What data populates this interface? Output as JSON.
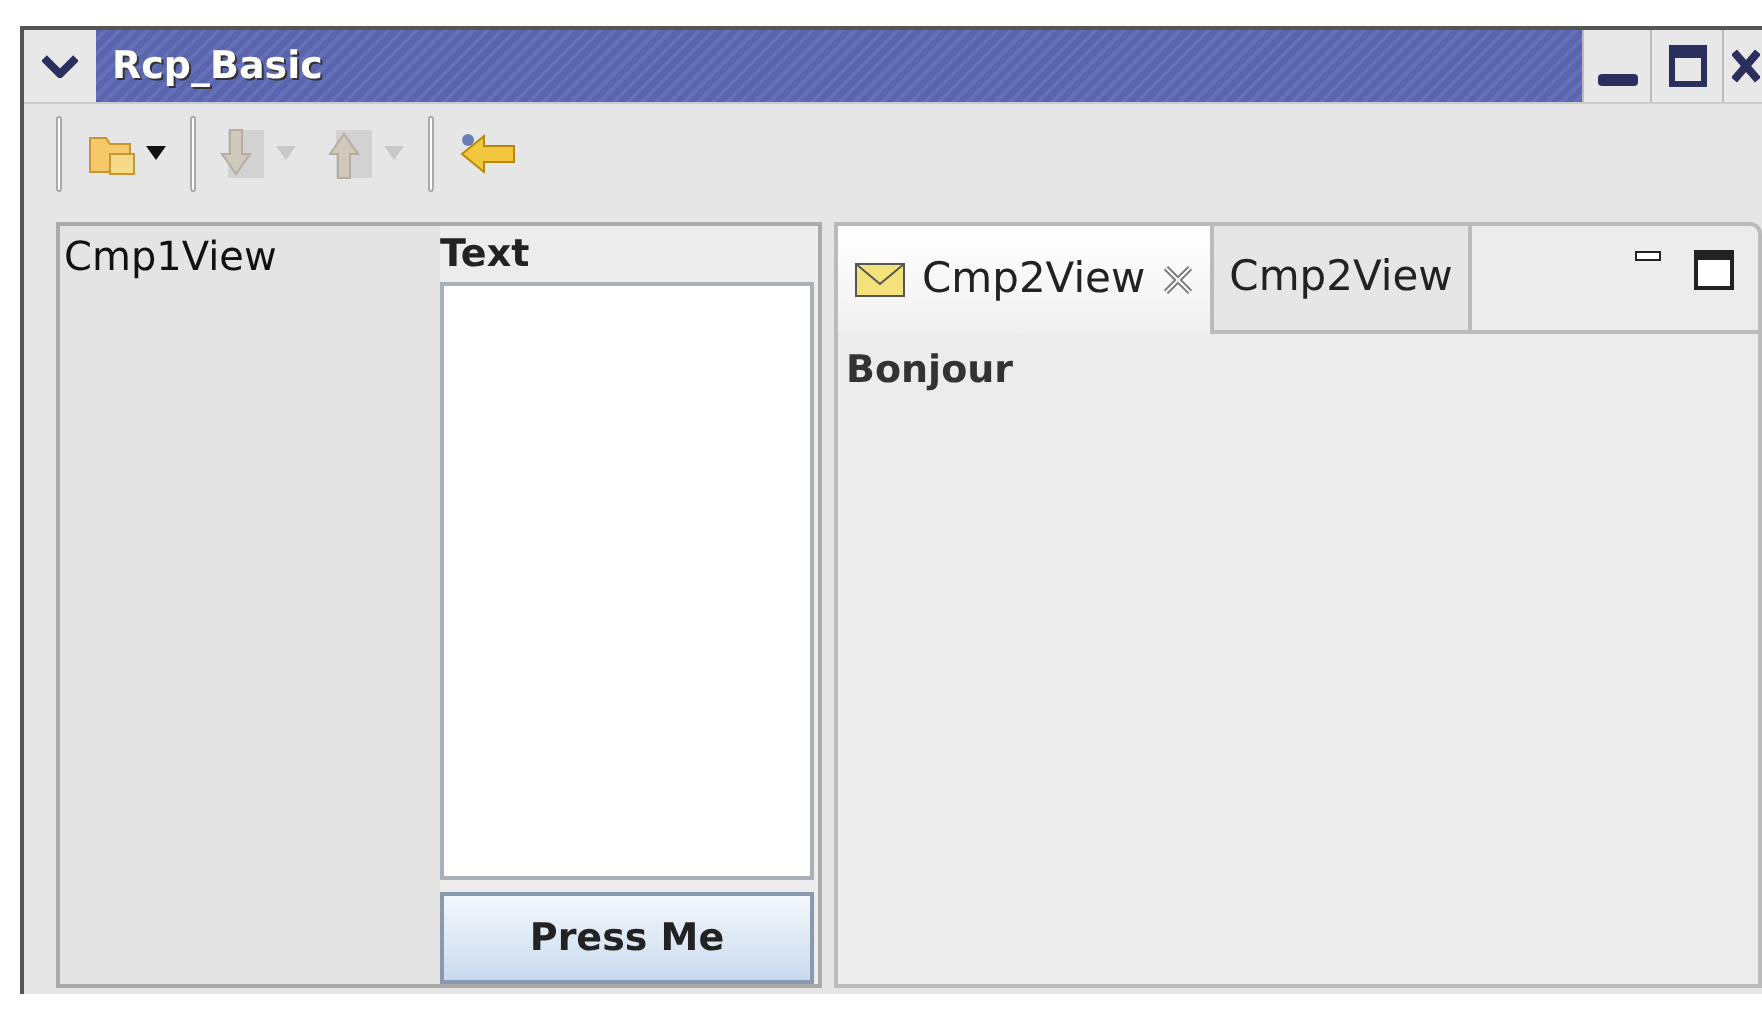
{
  "window": {
    "title": "Rcp_Basic"
  },
  "toolbar": [
    {
      "kind": "folder",
      "disabled": false,
      "dropdown": true
    },
    {
      "kind": "separator"
    },
    {
      "kind": "down",
      "disabled": true,
      "dropdown": true
    },
    {
      "kind": "up",
      "disabled": true,
      "dropdown": true
    },
    {
      "kind": "separator"
    },
    {
      "kind": "back",
      "disabled": false,
      "dropdown": false
    }
  ],
  "left_view": {
    "title": "Cmp1View",
    "label": "Text",
    "button": "Press Me"
  },
  "right_view": {
    "tabs": [
      {
        "label": "Cmp2View",
        "selected": true,
        "icon": true,
        "closable": true
      },
      {
        "label": "Cmp2View",
        "selected": false,
        "icon": false,
        "closable": false
      }
    ],
    "content": "Bonjour"
  }
}
